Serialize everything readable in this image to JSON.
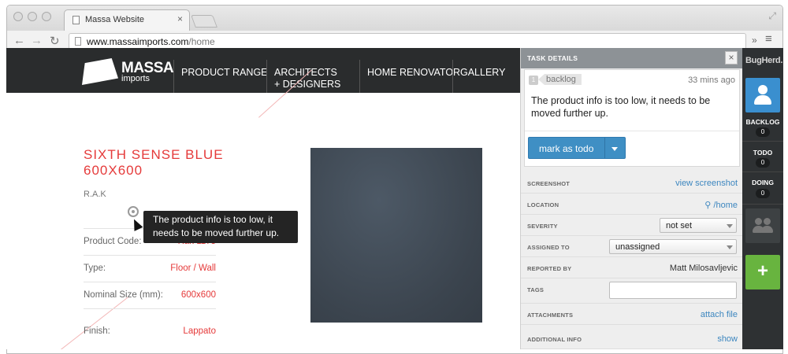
{
  "browser": {
    "tab_title": "Massa Website",
    "tab_close": "×",
    "url_host": "www.massaimports.com",
    "url_path": "/home",
    "back": "←",
    "forward": "→",
    "reload": "↻",
    "overflow": "»",
    "menu": "≡",
    "expand": "⤢"
  },
  "site": {
    "logo_word": "MASSA",
    "logo_sub": "imports",
    "nav": [
      {
        "label": "Product Range"
      },
      {
        "label": "Architects + Designers"
      },
      {
        "label": "Home Renovator"
      },
      {
        "label": "Gallery"
      }
    ],
    "product": {
      "title": "SIXTH SENSE BLUE 600X600",
      "brand": "R.A.K",
      "specs": [
        {
          "label": "Product Code:",
          "value": "Rak 1175"
        },
        {
          "label": "Type:",
          "value": "Floor / Wall"
        },
        {
          "label": "Nominal Size (mm):",
          "value": "600x600"
        },
        {
          "label": "Finish:",
          "value": "Lappato"
        }
      ]
    },
    "tooltip": "The product info is too low, it needs to be moved further up."
  },
  "task": {
    "header": "TASK DETAILS",
    "close": "×",
    "number": "1",
    "status": "backlog",
    "time": "33 mins ago",
    "description": "The product info is too low, it needs to be moved further up.",
    "action_label": "mark as todo",
    "fields": {
      "screenshot": {
        "label": "Screenshot",
        "value": "view screenshot"
      },
      "location": {
        "label": "Location",
        "pin": "⚲",
        "value": "/home"
      },
      "severity": {
        "label": "Severity",
        "value": "not set"
      },
      "assigned": {
        "label": "Assigned to",
        "value": "unassigned"
      },
      "reported": {
        "label": "Reported by",
        "value": "Matt Milosavljevic"
      },
      "tags": {
        "label": "Tags",
        "value": ""
      },
      "attachments": {
        "label": "Attachments",
        "value": "attach file"
      },
      "info": {
        "label": "Additional info",
        "value": "show"
      }
    }
  },
  "sidebar": {
    "logo": "BugHerd.",
    "columns": [
      {
        "label": "BACKLOG",
        "count": "0"
      },
      {
        "label": "TODO",
        "count": "0"
      },
      {
        "label": "DOING",
        "count": "0"
      }
    ],
    "add": "+"
  },
  "colors": {
    "accent_red": "#e53a3a",
    "button_blue": "#3f8fc4",
    "add_green": "#68b43f",
    "header_dark": "#2a2c2d"
  }
}
